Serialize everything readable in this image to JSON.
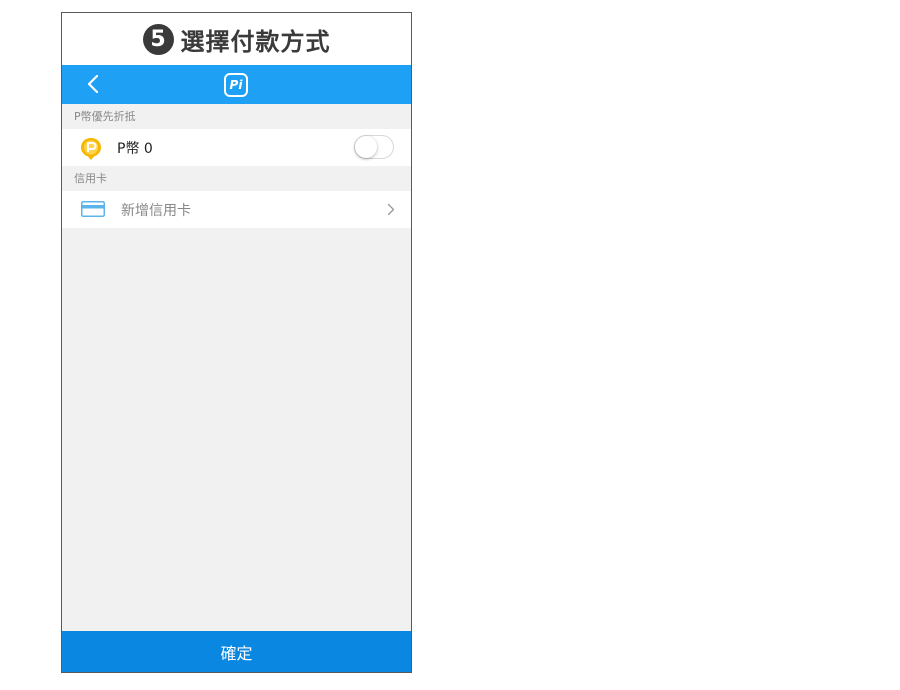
{
  "step": {
    "number": "5",
    "title": "選擇付款方式"
  },
  "navbar": {
    "back_icon": "chevron-left-icon",
    "logo_text": "Pi"
  },
  "points_section": {
    "header": "P幣優先折抵",
    "item_label": "P幣 0",
    "toggle_on": false
  },
  "card_section": {
    "header": "信用卡",
    "add_label": "新增信用卡"
  },
  "footer": {
    "confirm_label": "確定"
  },
  "colors": {
    "navbar": "#1ea0f5",
    "confirm": "#0a87e0",
    "coin": "#f5b800",
    "card_icon": "#5bb4ec"
  }
}
